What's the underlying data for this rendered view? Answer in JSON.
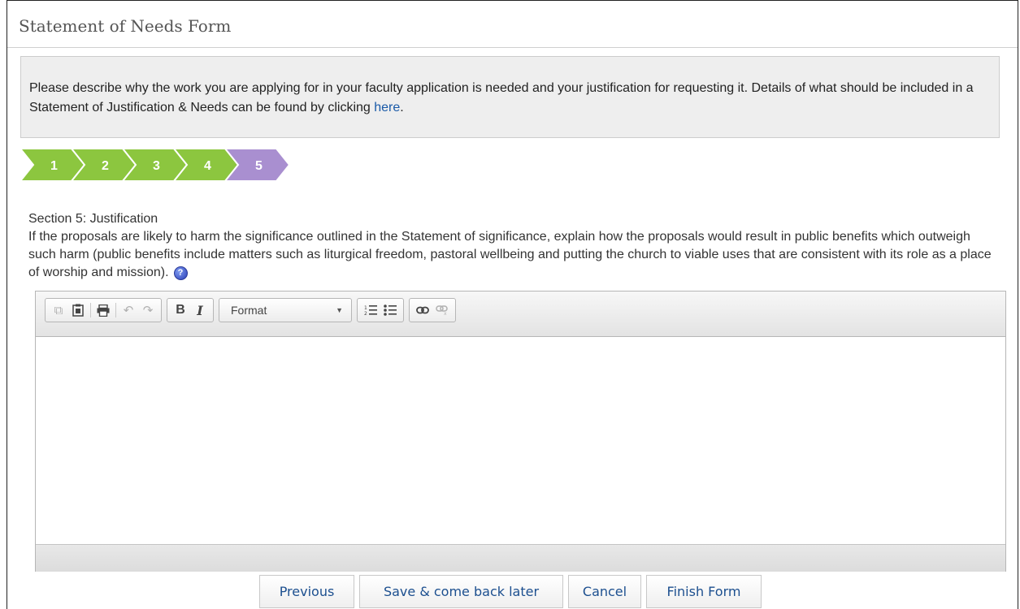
{
  "form": {
    "title": "Statement of Needs Form",
    "intro_text": "Please describe why the work you are applying for in your faculty application is needed and your justification for requesting it. Details of what should be included in a Statement of Justification & Needs can be found by clicking ",
    "intro_link": "here",
    "intro_end": "."
  },
  "steps": {
    "items": [
      "1",
      "2",
      "3",
      "4",
      "5"
    ],
    "current": 5,
    "done_color": "#8cc63f",
    "current_color": "#a98fd0"
  },
  "section": {
    "heading": "Section 5: Justification",
    "description": "If the proposals are likely to harm the significance outlined in the Statement of significance, explain how the proposals would result in public benefits which outweigh such harm (public benefits include matters such as liturgical freedom, pastoral wellbeing and putting the church to viable uses that are consistent with its role as a place of worship and mission).",
    "help_icon_glyph": "?"
  },
  "editor": {
    "toolbar": {
      "copy": "⧉",
      "paste": "📋",
      "print": "🖶",
      "undo": "↶",
      "redo": "↷",
      "bold": "B",
      "italic": "I",
      "format_label": "Format",
      "numbered_list": "⅟",
      "bulleted_list": "☰",
      "link": "🔗",
      "unlink": "⛓"
    },
    "content": ""
  },
  "actions": {
    "previous": "Previous",
    "save_later": "Save & come back later",
    "cancel": "Cancel",
    "finish": "Finish Form"
  }
}
